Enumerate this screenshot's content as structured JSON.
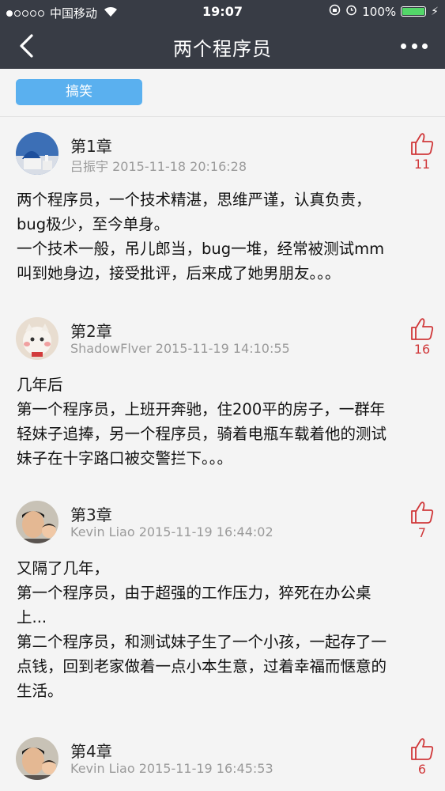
{
  "status_bar": {
    "carrier": "中国移动",
    "time": "19:07",
    "battery": "100%"
  },
  "nav": {
    "title": "两个程序员",
    "back_icon": "chevron-left-icon",
    "more_icon": "more-dots-icon"
  },
  "tag": {
    "label": "搞笑"
  },
  "colors": {
    "bar_bg": "#383c45",
    "tag_bg": "#5ab0ef",
    "like_red": "#d0383a",
    "battery_green": "#53d769"
  },
  "comments": [
    {
      "chapter": "第1章",
      "author": "吕振宇",
      "datetime": "2015-11-18 20:16:28",
      "likes": "11",
      "lines": [
        "两个程序员，一个技术精湛，思维严谨，认真负责，",
        "bug极少，至今单身。",
        "一个技术一般，吊儿郎当，bug一堆，经常被测试mm",
        "叫到她身边，接受批评，后来成了她男朋友。。。"
      ]
    },
    {
      "chapter": "第2章",
      "author": "ShadowFlver",
      "datetime": "2015-11-19 14:10:55",
      "likes": "16",
      "lines": [
        "几年后",
        "第一个程序员，上班开奔驰，住200平的房子，一群年",
        "轻妹子追捧，另一个程序员，骑着电瓶车载着他的测试",
        "妹子在十字路口被交警拦下。。。"
      ]
    },
    {
      "chapter": "第3章",
      "author": "Kevin Liao",
      "datetime": "2015-11-19 16:44:02",
      "likes": "7",
      "lines": [
        "又隔了几年，",
        "第一个程序员，由于超强的工作压力，猝死在办公桌",
        "上...",
        "第二个程序员，和测试妹子生了一个小孩，一起存了一",
        "点钱，回到老家做着一点小本生意，过着幸福而惬意的",
        "生活。"
      ]
    },
    {
      "chapter": "第4章",
      "author": "Kevin Liao",
      "datetime": "2015-11-19 16:45:53",
      "likes": "6",
      "lines": []
    }
  ]
}
